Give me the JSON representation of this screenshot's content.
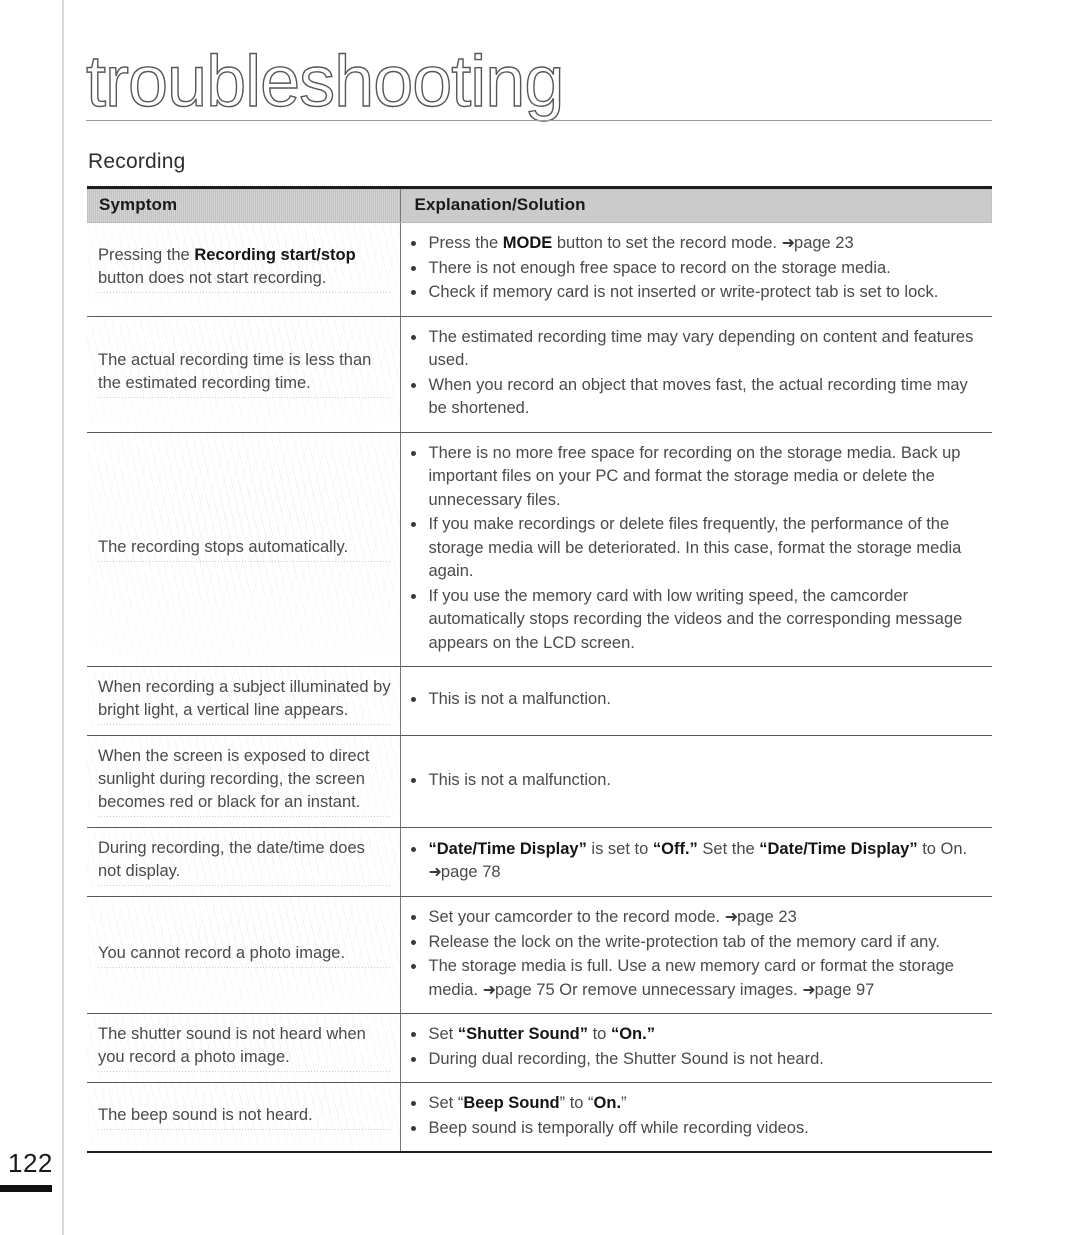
{
  "page": {
    "title": "troubleshooting",
    "section_heading": "Recording",
    "folio": "122"
  },
  "table": {
    "headers": {
      "symptom": "Symptom",
      "explanation": "Explanation/Solution"
    },
    "rows": [
      {
        "symptom_html": "Pressing the <b>Recording start/stop</b> button does not start recording.",
        "symptom_text": "Pressing the Recording start/stop button does not start recording.",
        "solutions_html": [
          "Press the <b>MODE</b> button to set the record mode. <span class=\"arrow\">➜</span>page 23",
          "There is not enough free space to record on the storage media.",
          "Check if memory card is not inserted or write-protect tab is set to lock."
        ]
      },
      {
        "symptom_html": "The actual recording time is less than the estimated recording time.",
        "symptom_text": "The actual recording time is less than the estimated recording time.",
        "solutions_html": [
          "The estimated recording time may vary depending on content and features used.",
          "When you record an object that moves fast, the actual recording time may be shortened."
        ]
      },
      {
        "symptom_html": "The recording stops automatically.",
        "symptom_text": "The recording stops automatically.",
        "solutions_html": [
          "There is no more free space for recording on the storage media. Back up important files on your PC and format the storage media or delete the unnecessary files.",
          "If you make recordings or delete files frequently, the performance of the storage media will be deteriorated. In this case, format the storage media again.",
          "If you use the memory card with low writing speed, the camcorder automatically stops recording the videos and the corresponding message appears on the LCD screen."
        ]
      },
      {
        "symptom_html": "When recording a subject illuminated by bright light, a vertical line appears.",
        "symptom_text": "When recording a subject illuminated by bright light, a vertical line appears.",
        "solutions_html": [
          "This is not a malfunction."
        ]
      },
      {
        "symptom_html": "When the screen is exposed to direct sunlight during recording, the screen becomes red or black for an instant.",
        "symptom_text": "When the screen is exposed to direct sunlight during recording, the screen becomes red or black for an instant.",
        "solutions_html": [
          "This is not a malfunction."
        ]
      },
      {
        "symptom_html": "During recording, the date/time does not display.",
        "symptom_text": "During recording, the date/time does not display.",
        "solutions_html": [
          "<b>“Date/Time Display”</b> is set to <b>“Off.”</b> Set the <b>“Date/Time Display”</b> to On. <span class=\"arrow\">➜</span>page 78"
        ]
      },
      {
        "symptom_html": "You cannot record a photo image.",
        "symptom_text": "You cannot record a photo image.",
        "solutions_html": [
          "Set your camcorder to the record mode. <span class=\"arrow\">➜</span>page 23",
          "Release the lock on the write-protection tab of the memory card if any.",
          "The storage media is full. Use a new memory card or format the storage media. <span class=\"arrow\">➜</span>page 75 Or remove unnecessary images. <span class=\"arrow\">➜</span>page 97"
        ]
      },
      {
        "symptom_html": "The shutter sound is not heard when you record a photo image.",
        "symptom_text": "The shutter sound is not heard when you record a photo image.",
        "solutions_html": [
          "Set <b>“Shutter Sound”</b> to <b>“On.”</b>",
          "During dual recording, the Shutter Sound is not heard."
        ]
      },
      {
        "symptom_html": "The beep sound is not heard.",
        "symptom_text": "The beep sound is not heard.",
        "solutions_html": [
          "Set “<b>Beep Sound</b>” to “<b>On.</b>”",
          "Beep sound is temporally off while recording videos."
        ]
      }
    ]
  }
}
